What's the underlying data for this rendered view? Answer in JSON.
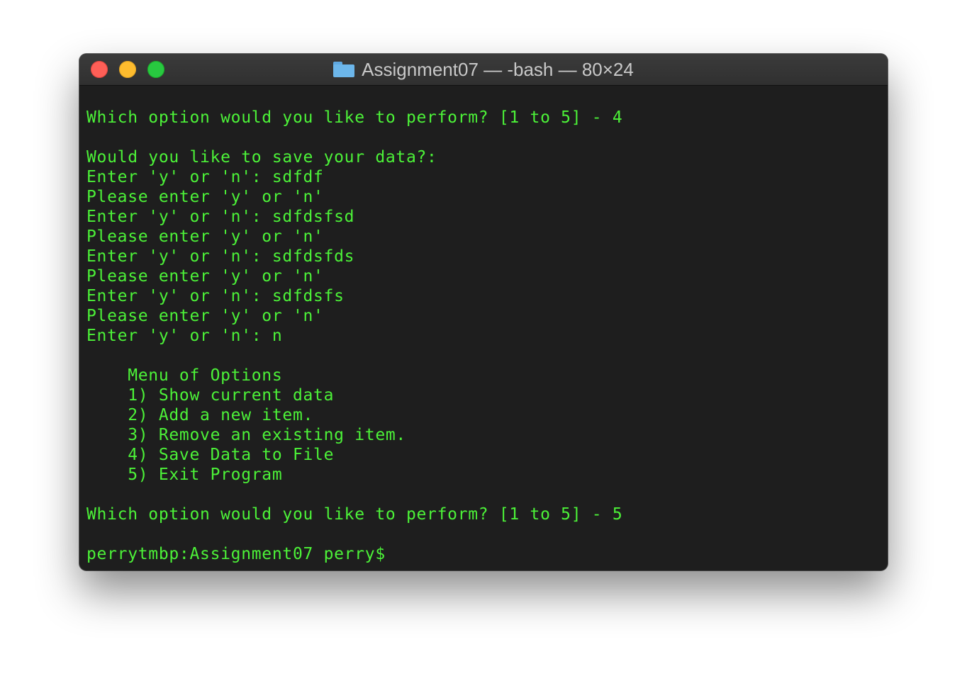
{
  "window": {
    "title": "Assignment07 — -bash — 80×24",
    "folder_icon": "folder-icon",
    "colors": {
      "text": "#4cf238",
      "background": "#1e1e1e",
      "titlebar": "#333333"
    }
  },
  "terminal": {
    "lines": [
      "Which option would you like to perform? [1 to 5] - 4",
      "",
      "Would you like to save your data?:",
      "Enter 'y' or 'n': sdfdf",
      "Please enter 'y' or 'n'",
      "Enter 'y' or 'n': sdfdsfsd",
      "Please enter 'y' or 'n'",
      "Enter 'y' or 'n': sdfdsfds",
      "Please enter 'y' or 'n'",
      "Enter 'y' or 'n': sdfdsfs",
      "Please enter 'y' or 'n'",
      "Enter 'y' or 'n': n",
      "",
      "    Menu of Options",
      "    1) Show current data",
      "    2) Add a new item.",
      "    3) Remove an existing item.",
      "    4) Save Data to File",
      "    5) Exit Program",
      "",
      "Which option would you like to perform? [1 to 5] - 5",
      "",
      "perrytmbp:Assignment07 perry$"
    ]
  }
}
